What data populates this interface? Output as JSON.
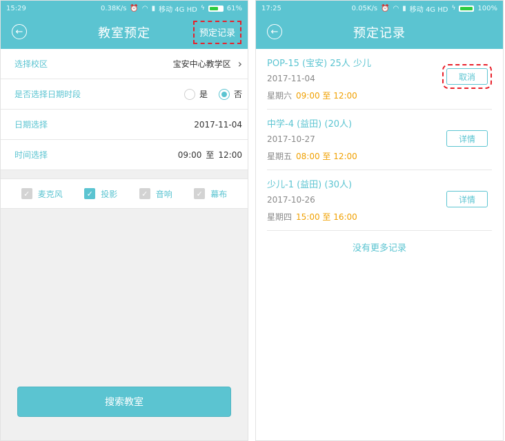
{
  "left": {
    "status": {
      "time": "15:29",
      "speed": "0.38K/s",
      "carrier": "移动 4G HD",
      "battery": "61%",
      "battery_level": 0.61
    },
    "nav": {
      "title": "教室预定",
      "action": "预定记录"
    },
    "form": {
      "campus": {
        "label": "选择校区",
        "value": "宝安中心教学区"
      },
      "period": {
        "label": "是否选择日期时段",
        "yes": "是",
        "no": "否",
        "selected": "否"
      },
      "date": {
        "label": "日期选择",
        "value": "2017-11-04"
      },
      "time": {
        "label": "时间选择",
        "start": "09:00",
        "sep": "至",
        "end": "12:00"
      }
    },
    "equipment": [
      {
        "label": "麦克风",
        "checked": false
      },
      {
        "label": "投影",
        "checked": true
      },
      {
        "label": "音响",
        "checked": false
      },
      {
        "label": "幕布",
        "checked": false
      }
    ],
    "search_label": "搜索教室"
  },
  "right": {
    "status": {
      "time": "17:25",
      "speed": "0.05K/s",
      "carrier": "移动 4G HD",
      "battery": "100%",
      "battery_level": 1.0
    },
    "nav": {
      "title": "预定记录"
    },
    "records": [
      {
        "title": "POP-15 (宝安) 25人 少儿",
        "date": "2017-11-04",
        "weekday": "星期六",
        "time": "09:00 至 12:00",
        "action": "取消"
      },
      {
        "title": "中学-4 (益田) (20人)",
        "date": "2017-10-27",
        "weekday": "星期五",
        "time": "08:00 至 12:00",
        "action": "详情"
      },
      {
        "title": "少儿-1 (益田) (30人)",
        "date": "2017-10-26",
        "weekday": "星期四",
        "time": "15:00 至 16:00",
        "action": "详情"
      }
    ],
    "no_more": "没有更多记录"
  },
  "colors": {
    "accent": "#5bc4d1",
    "time_highlight": "#f0a000",
    "annotation": "#e8202a"
  }
}
